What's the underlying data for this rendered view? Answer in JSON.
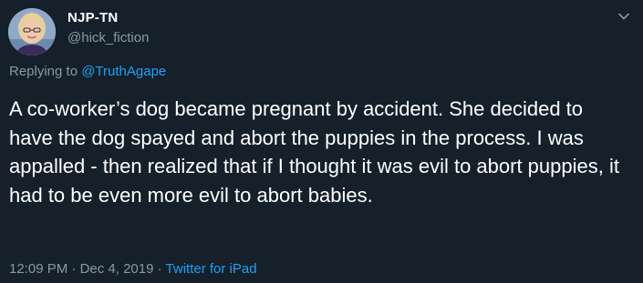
{
  "user": {
    "display_name": "NJP-TN",
    "handle": "@hick_fiction"
  },
  "reply": {
    "prefix": "Replying to",
    "target": "@TruthAgape"
  },
  "tweet": {
    "text": "A co-worker’s dog became pregnant by accident. She decided to have the dog spayed and abort the puppies in the process. I was appalled - then realized that if I thought it was evil to abort puppies, it had to be even more evil to abort babies."
  },
  "meta": {
    "time": "12:09 PM",
    "date": "Dec 4, 2019",
    "separator": "·",
    "source": "Twitter for iPad"
  },
  "icons": {
    "avatar": "profile-photo",
    "menu": "chevron-down-icon"
  },
  "colors": {
    "background": "#15202b",
    "text": "#ffffff",
    "muted": "#8899a6",
    "link": "#1da1f2"
  }
}
